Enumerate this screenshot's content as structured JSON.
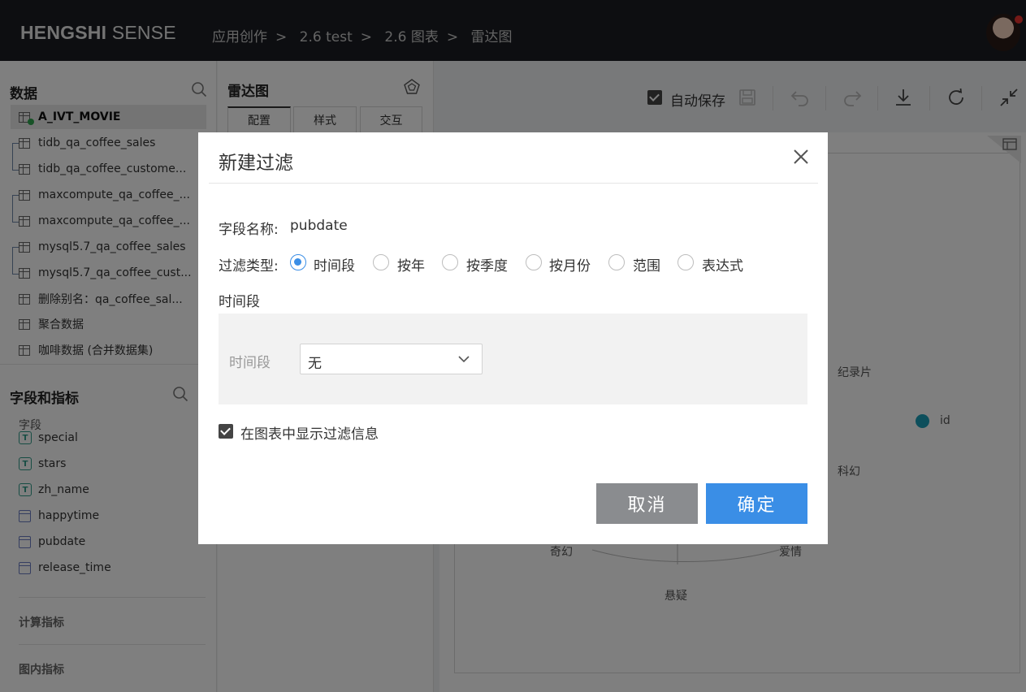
{
  "app": {
    "logo_bold": "HENGSHI",
    "logo_light": " SENSE"
  },
  "breadcrumb": [
    "应用创作",
    "2.6 test",
    "2.6 图表",
    "雷达图"
  ],
  "breadcrumb_sep": ">",
  "data_panel": {
    "title": "数据",
    "datasets": [
      "A_IVT_MOVIE",
      "tidb_qa_coffee_sales",
      "tidb_qa_coffee_custome...",
      "maxcompute_qa_coffee_...",
      "maxcompute_qa_coffee_...",
      "mysql5.7_qa_coffee_sales",
      "mysql5.7_qa_coffee_cust...",
      "删除别名：qa_coffee_sal...",
      "聚合数据",
      "咖啡数据 (合并数据集)"
    ]
  },
  "fields_panel": {
    "title": "字段和指标",
    "section_fields": "字段",
    "fields": [
      {
        "name": "special",
        "type": "text"
      },
      {
        "name": "stars",
        "type": "text"
      },
      {
        "name": "zh_name",
        "type": "text"
      },
      {
        "name": "happytime",
        "type": "date"
      },
      {
        "name": "pubdate",
        "type": "date"
      },
      {
        "name": "release_time",
        "type": "date"
      }
    ],
    "section_calc": "计算指标",
    "section_inchart": "图内指标"
  },
  "config_panel": {
    "title": "雷达图",
    "tabs": [
      "配置",
      "样式",
      "交互"
    ]
  },
  "toolbar": {
    "autosave_label": "自动保存",
    "autosave_checked": true
  },
  "chart_preview": {
    "labels": [
      "纪录片",
      "科幻",
      "爱情",
      "悬疑",
      "奇幻"
    ],
    "legend": "id",
    "legend_color": "#1a9fb8"
  },
  "dialog": {
    "title": "新建过滤",
    "field_label": "字段名称:",
    "field_value": "pubdate",
    "type_label": "过滤类型:",
    "types": [
      "时间段",
      "按年",
      "按季度",
      "按月份",
      "范围",
      "表达式"
    ],
    "selected_type": "时间段",
    "section_title": "时间段",
    "range_label": "时间段",
    "range_value": "无",
    "show_info_label": "在图表中显示过滤信息",
    "show_info_checked": true,
    "cancel_label": "取消",
    "ok_label": "确定",
    "ok_color": "#3a8ee6",
    "cancel_color": "#8a8c8f"
  }
}
